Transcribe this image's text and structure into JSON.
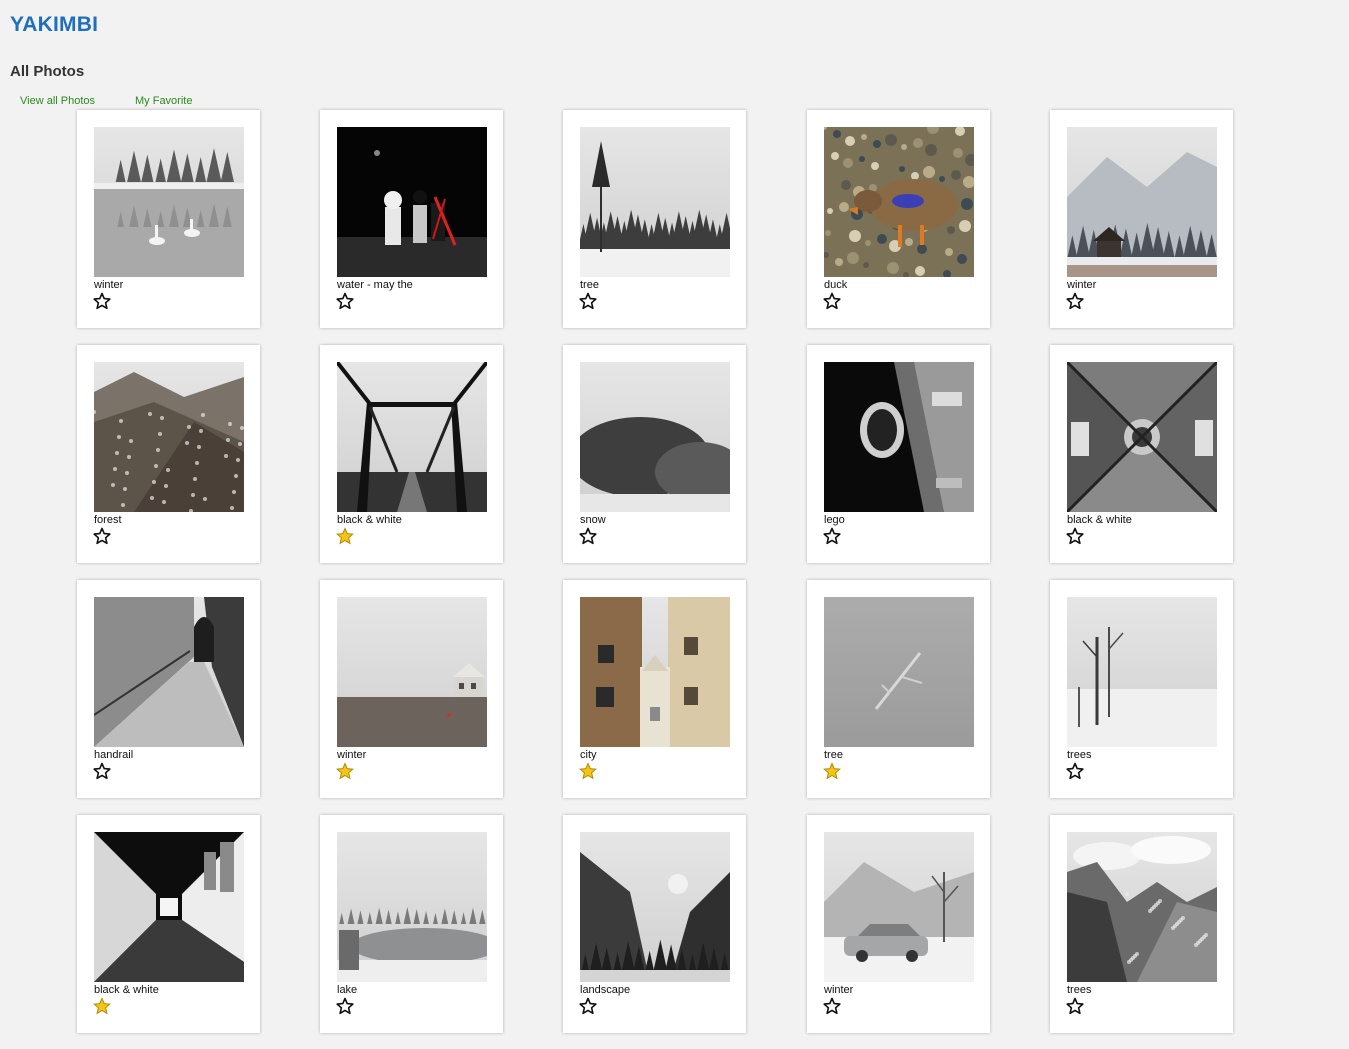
{
  "app": {
    "title": "YAKIMBI"
  },
  "page": {
    "title": "All Photos"
  },
  "nav": {
    "view_all": "View all Photos",
    "my_favorite": "My Favorite"
  },
  "colors": {
    "brand": "#1f6fbf",
    "link": "#2a8a1e",
    "star_fav": "#f2c618",
    "star_outline": "#111111"
  },
  "photos": [
    {
      "caption": "winter",
      "favorite": false,
      "scene": "swans-lake"
    },
    {
      "caption": "water - may the",
      "favorite": false,
      "scene": "lego-dark"
    },
    {
      "caption": "tree",
      "favorite": false,
      "scene": "snow-forest"
    },
    {
      "caption": "duck",
      "favorite": false,
      "scene": "duck"
    },
    {
      "caption": "winter",
      "favorite": false,
      "scene": "cabin-snow"
    },
    {
      "caption": "forest",
      "favorite": false,
      "scene": "mountain-forest"
    },
    {
      "caption": "black & white",
      "favorite": true,
      "scene": "bridge-bw"
    },
    {
      "caption": "snow",
      "favorite": false,
      "scene": "snow-fog"
    },
    {
      "caption": "lego",
      "favorite": false,
      "scene": "lego-bw"
    },
    {
      "caption": "black & white",
      "favorite": false,
      "scene": "cathedral-bw"
    },
    {
      "caption": "handrail",
      "favorite": false,
      "scene": "alley-bw"
    },
    {
      "caption": "winter",
      "favorite": true,
      "scene": "castle-fog"
    },
    {
      "caption": "city",
      "favorite": true,
      "scene": "city-buildings"
    },
    {
      "caption": "tree",
      "favorite": true,
      "scene": "branch-dark"
    },
    {
      "caption": "trees",
      "favorite": false,
      "scene": "trees-snow"
    },
    {
      "caption": "black & white",
      "favorite": true,
      "scene": "tunnel-bw"
    },
    {
      "caption": "lake",
      "favorite": false,
      "scene": "lake-snow"
    },
    {
      "caption": "landscape",
      "favorite": false,
      "scene": "valley-sun"
    },
    {
      "caption": "winter",
      "favorite": false,
      "scene": "car-snow"
    },
    {
      "caption": "trees",
      "favorite": false,
      "scene": "mountain-sky"
    }
  ]
}
